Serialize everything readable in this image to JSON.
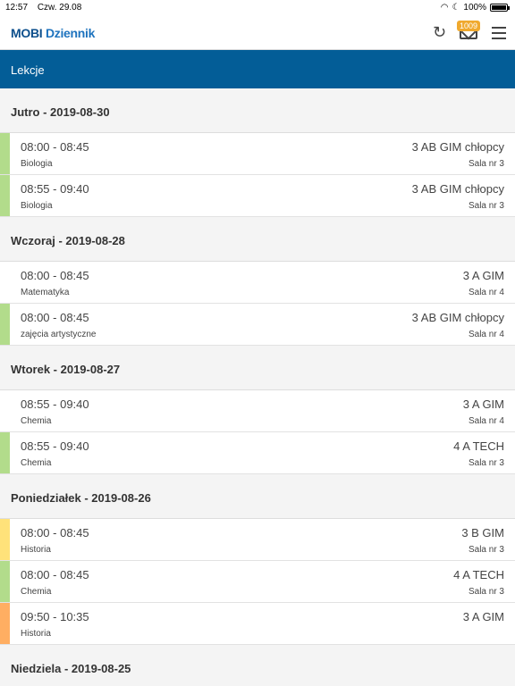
{
  "status": {
    "time": "12:57",
    "date": "Czw. 29.08",
    "battery": "100%"
  },
  "header": {
    "logo_a": "MOBI",
    "logo_b": "Dziennik",
    "badge": "1009",
    "title": "Lekcje"
  },
  "colors": {
    "green": "#b2dc8b",
    "yellow": "#ffe27a",
    "orange": "#ffae62",
    "brand": "#035d97"
  },
  "days": [
    {
      "label": "Jutro  -  2019-08-30",
      "lessons": [
        {
          "time": "08:00 - 08:45",
          "subject": "Biologia",
          "class": "3 AB GIM chłopcy",
          "room": "Sala nr 3",
          "color": "green"
        },
        {
          "time": "08:55 - 09:40",
          "subject": "Biologia",
          "class": "3 AB GIM chłopcy",
          "room": "Sala nr 3",
          "color": "green"
        }
      ]
    },
    {
      "label": "Wczoraj  -  2019-08-28",
      "lessons": [
        {
          "time": "08:00 - 08:45",
          "subject": "Matematyka",
          "class": "3 A GIM",
          "room": "Sala nr 4",
          "color": "none"
        },
        {
          "time": "08:00 - 08:45",
          "subject": "zajęcia artystyczne",
          "class": "3 AB GIM chłopcy",
          "room": "Sala nr 4",
          "color": "green"
        }
      ]
    },
    {
      "label": "Wtorek  -  2019-08-27",
      "lessons": [
        {
          "time": "08:55 - 09:40",
          "subject": "Chemia",
          "class": "3 A GIM",
          "room": "Sala nr 4",
          "color": "none"
        },
        {
          "time": "08:55 - 09:40",
          "subject": "Chemia",
          "class": "4 A TECH",
          "room": "Sala nr 3",
          "color": "green"
        }
      ]
    },
    {
      "label": "Poniedziałek  -  2019-08-26",
      "lessons": [
        {
          "time": "08:00 - 08:45",
          "subject": "Historia",
          "class": "3 B GIM",
          "room": "Sala nr 3",
          "color": "yellow"
        },
        {
          "time": "08:00 - 08:45",
          "subject": "Chemia",
          "class": "4 A TECH",
          "room": "Sala nr 3",
          "color": "green"
        },
        {
          "time": "09:50 - 10:35",
          "subject": "Historia",
          "class": "3 A GIM",
          "room": "",
          "color": "orange"
        }
      ]
    },
    {
      "label": "Niedziela  -  2019-08-25",
      "lessons": []
    }
  ]
}
